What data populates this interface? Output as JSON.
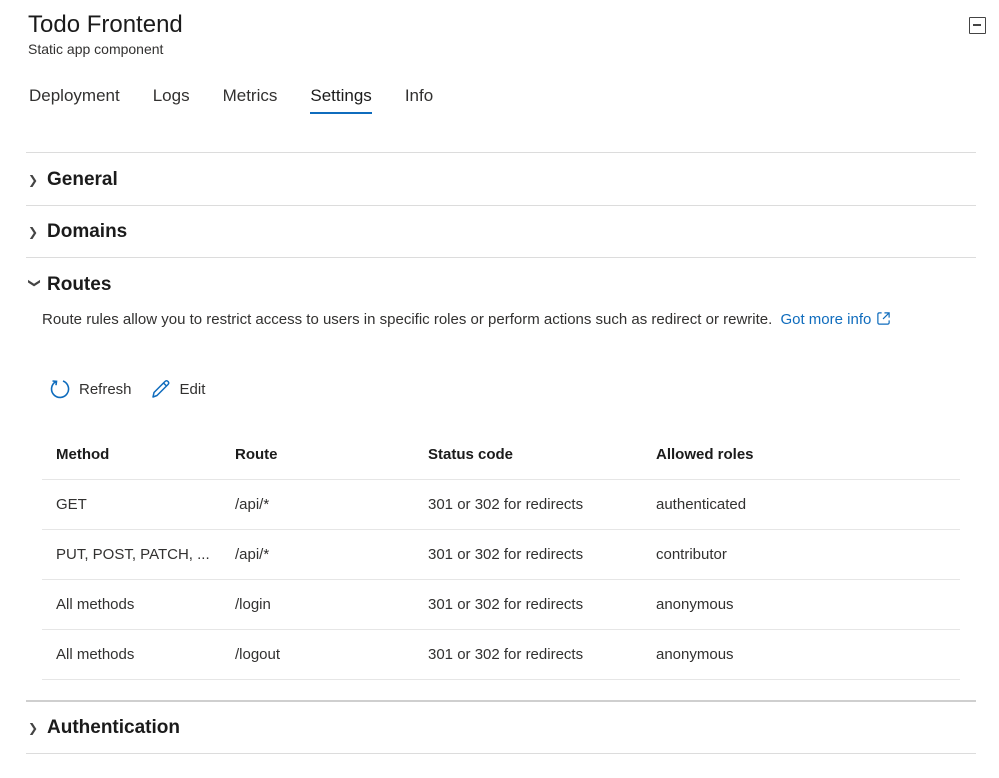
{
  "header": {
    "title": "Todo Frontend",
    "subtitle": "Static app component"
  },
  "tabs": [
    {
      "label": "Deployment",
      "active": false
    },
    {
      "label": "Logs",
      "active": false
    },
    {
      "label": "Metrics",
      "active": false
    },
    {
      "label": "Settings",
      "active": true
    },
    {
      "label": "Info",
      "active": false
    }
  ],
  "sections": {
    "general": {
      "title": "General",
      "expanded": false
    },
    "domains": {
      "title": "Domains",
      "expanded": false
    },
    "routes": {
      "title": "Routes",
      "expanded": true,
      "description": "Route rules allow you to restrict access to users in specific roles or perform actions such as redirect or rewrite.",
      "link_text": "Got more info"
    },
    "authentication": {
      "title": "Authentication",
      "expanded": false
    }
  },
  "toolbar": {
    "refresh_label": "Refresh",
    "edit_label": "Edit"
  },
  "table": {
    "columns": [
      "Method",
      "Route",
      "Status code",
      "Allowed roles"
    ],
    "rows": [
      [
        "GET",
        "/api/*",
        "301 or 302 for redirects",
        "authenticated"
      ],
      [
        "PUT, POST, PATCH, ...",
        "/api/*",
        "301 or 302 for redirects",
        "contributor"
      ],
      [
        "All methods",
        "/login",
        "301 or 302 for redirects",
        "anonymous"
      ],
      [
        "All methods",
        "/logout",
        "301 or 302 for redirects",
        "anonymous"
      ]
    ]
  },
  "colors": {
    "accent": "#0f6cbd",
    "text": "#323130",
    "divider": "#dcdcdc"
  }
}
